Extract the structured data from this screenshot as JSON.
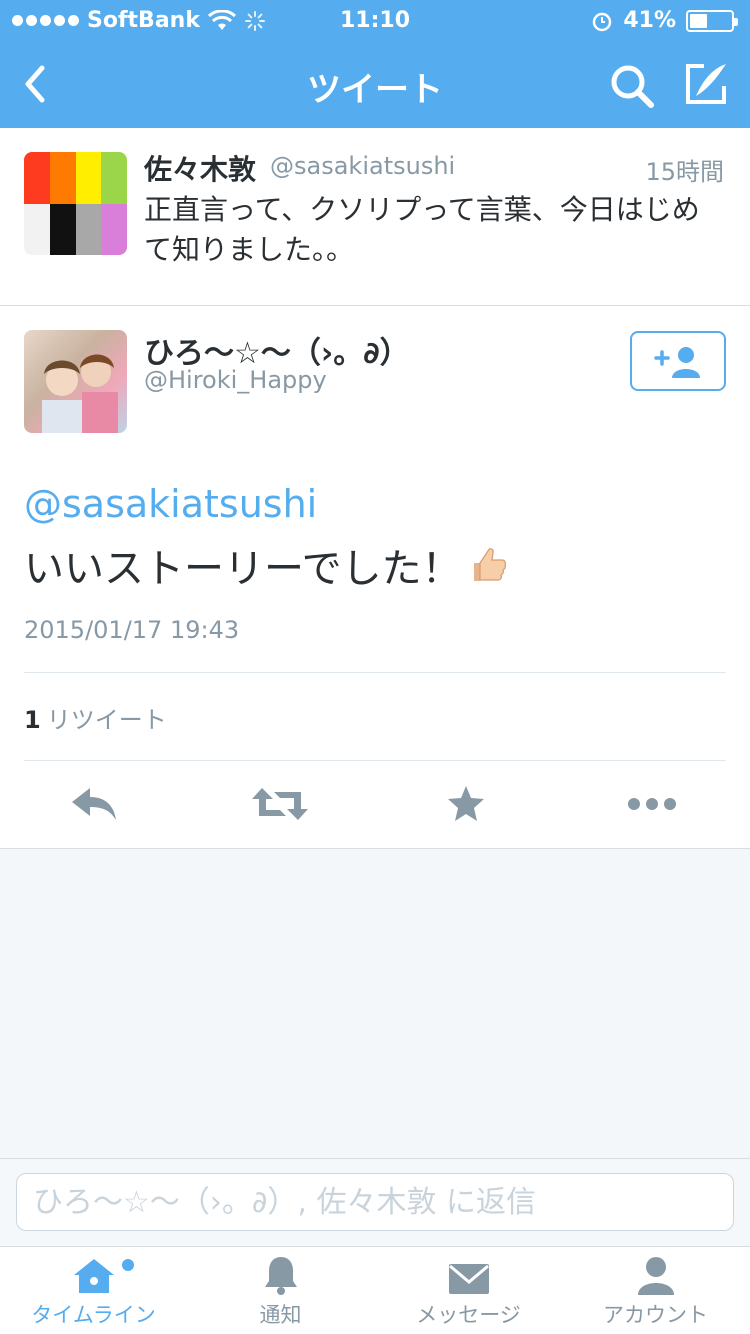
{
  "status_bar": {
    "carrier": "SoftBank",
    "time": "11:10",
    "battery": "41%",
    "battery_level": 0.41
  },
  "nav": {
    "title": "ツイート"
  },
  "parent_tweet": {
    "name": "佐々木敦",
    "handle": "@sasakiatsushi",
    "time": "15時間",
    "text": "正直言って、クソリプって言葉、今日はじめて知りました。。"
  },
  "main_tweet": {
    "name": "ひろ〜☆〜（›。∂）",
    "handle": "@Hiroki_Happy",
    "mention": "@sasakiatsushi",
    "text": "いいストーリーでした！",
    "timestamp": "2015/01/17 19:43",
    "retweet_count": "1",
    "retweet_label": "リツイート"
  },
  "reply": {
    "placeholder": "ひろ〜☆〜（›。∂）, 佐々木敦 に返信"
  },
  "tabs": [
    {
      "label": "タイムライン",
      "icon": "home-icon",
      "active": true
    },
    {
      "label": "通知",
      "icon": "bell-icon",
      "active": false
    },
    {
      "label": "メッセージ",
      "icon": "envelope-icon",
      "active": false
    },
    {
      "label": "アカウント",
      "icon": "person-icon",
      "active": false
    }
  ],
  "colors": {
    "brand": "#55acee",
    "text": "#292f33",
    "muted": "#8899a6"
  }
}
